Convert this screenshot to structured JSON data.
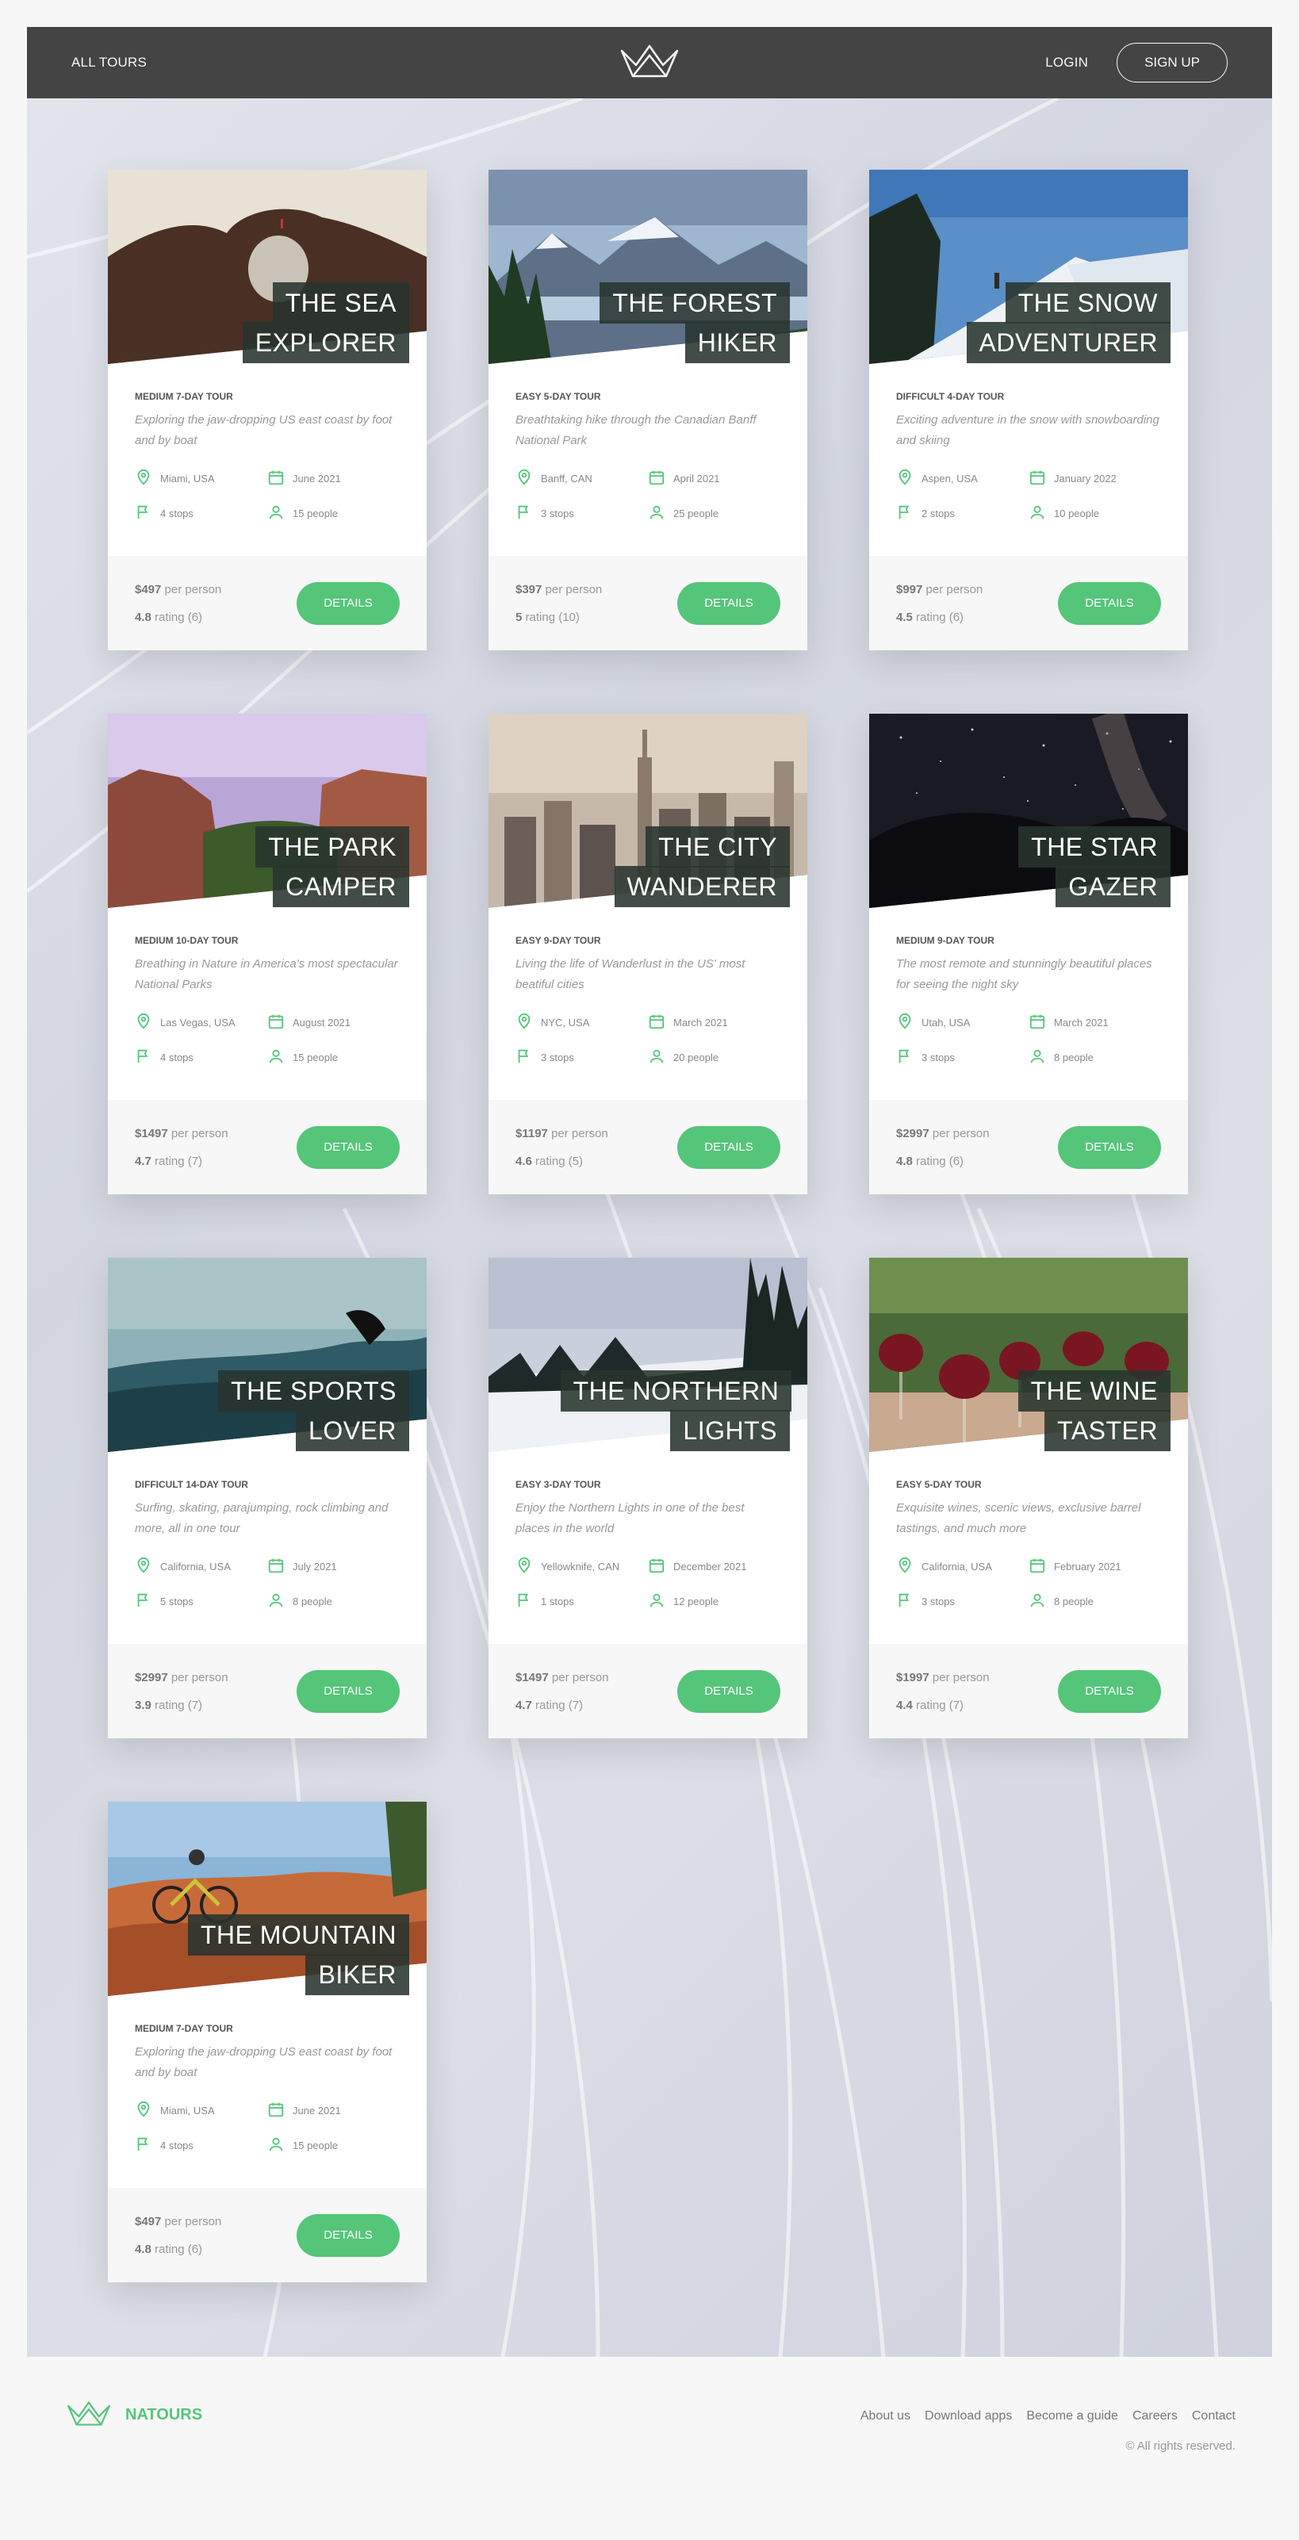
{
  "header": {
    "all_tours": "ALL TOURS",
    "login": "LOGIN",
    "signup": "SIGN UP",
    "logo_icon": "crown-logo-icon"
  },
  "colors": {
    "accent": "#55c57a",
    "header_bg": "#444444",
    "heading_bg": "#28342e"
  },
  "tours": [
    {
      "title": "THE SEA EXPLORER",
      "subtitle": "MEDIUM 7-DAY TOUR",
      "summary": "Exploring the jaw-dropping US east coast by foot and by boat",
      "location": "Miami, USA",
      "date": "June 2021",
      "stops": "4 stops",
      "people": "15 people",
      "price": "$497",
      "per": "per person",
      "rating": "4.8",
      "rating_label": "rating (6)",
      "button": "DETAILS",
      "scene": "sea"
    },
    {
      "title": "THE FOREST HIKER",
      "subtitle": "EASY 5-DAY TOUR",
      "summary": "Breathtaking hike through the Canadian Banff National Park",
      "location": "Banff, CAN",
      "date": "April 2021",
      "stops": "3 stops",
      "people": "25 people",
      "price": "$397",
      "per": "per person",
      "rating": "5",
      "rating_label": "rating (10)",
      "button": "DETAILS",
      "scene": "forest"
    },
    {
      "title": "THE SNOW ADVENTURER",
      "subtitle": "DIFFICULT 4-DAY TOUR",
      "summary": "Exciting adventure in the snow with snowboarding and skiing",
      "location": "Aspen, USA",
      "date": "January 2022",
      "stops": "2 stops",
      "people": "10 people",
      "price": "$997",
      "per": "per person",
      "rating": "4.5",
      "rating_label": "rating (6)",
      "button": "DETAILS",
      "scene": "snow"
    },
    {
      "title": "THE PARK CAMPER",
      "subtitle": "MEDIUM 10-DAY TOUR",
      "summary": "Breathing in Nature in America's most spectacular National Parks",
      "location": "Las Vegas, USA",
      "date": "August 2021",
      "stops": "4 stops",
      "people": "15 people",
      "price": "$1497",
      "per": "per person",
      "rating": "4.7",
      "rating_label": "rating (7)",
      "button": "DETAILS",
      "scene": "park"
    },
    {
      "title": "THE CITY WANDERER",
      "subtitle": "EASY 9-DAY TOUR",
      "summary": "Living the life of Wanderlust in the US' most beatiful cities",
      "location": "NYC, USA",
      "date": "March 2021",
      "stops": "3 stops",
      "people": "20 people",
      "price": "$1197",
      "per": "per person",
      "rating": "4.6",
      "rating_label": "rating (5)",
      "button": "DETAILS",
      "scene": "city"
    },
    {
      "title": "THE STAR GAZER",
      "subtitle": "MEDIUM 9-DAY TOUR",
      "summary": "The most remote and stunningly beautiful places for seeing the night sky",
      "location": "Utah, USA",
      "date": "March 2021",
      "stops": "3 stops",
      "people": "8 people",
      "price": "$2997",
      "per": "per person",
      "rating": "4.8",
      "rating_label": "rating (6)",
      "button": "DETAILS",
      "scene": "stars"
    },
    {
      "title": "THE SPORTS LOVER",
      "subtitle": "DIFFICULT 14-DAY TOUR",
      "summary": "Surfing, skating, parajumping, rock climbing and more, all in one tour",
      "location": "California, USA",
      "date": "July 2021",
      "stops": "5 stops",
      "people": "8 people",
      "price": "$2997",
      "per": "per person",
      "rating": "3.9",
      "rating_label": "rating (7)",
      "button": "DETAILS",
      "scene": "surf"
    },
    {
      "title": "THE NORTHERN LIGHTS",
      "subtitle": "EASY 3-DAY TOUR",
      "summary": "Enjoy the Northern Lights in one of the best places in the world",
      "location": "Yellowknife, CAN",
      "date": "December 2021",
      "stops": "1 stops",
      "people": "12 people",
      "price": "$1497",
      "per": "per person",
      "rating": "4.7",
      "rating_label": "rating (7)",
      "button": "DETAILS",
      "scene": "northern"
    },
    {
      "title": "THE WINE TASTER",
      "subtitle": "EASY 5-DAY TOUR",
      "summary": "Exquisite wines, scenic views, exclusive barrel tastings, and much more",
      "location": "California, USA",
      "date": "February 2021",
      "stops": "3 stops",
      "people": "8 people",
      "price": "$1997",
      "per": "per person",
      "rating": "4.4",
      "rating_label": "rating (7)",
      "button": "DETAILS",
      "scene": "wine"
    },
    {
      "title": "THE MOUNTAIN BIKER",
      "subtitle": "MEDIUM 7-DAY TOUR",
      "summary": "Exploring the jaw-dropping US east coast by foot and by boat",
      "location": "Miami, USA",
      "date": "June 2021",
      "stops": "4 stops",
      "people": "15 people",
      "price": "$497",
      "per": "per person",
      "rating": "4.8",
      "rating_label": "rating (6)",
      "button": "DETAILS",
      "scene": "bike"
    }
  ],
  "footer": {
    "brand": "NATOURS",
    "links": [
      "About us",
      "Download apps",
      "Become a guide",
      "Careers",
      "Contact"
    ],
    "copyright": "© All rights reserved."
  }
}
